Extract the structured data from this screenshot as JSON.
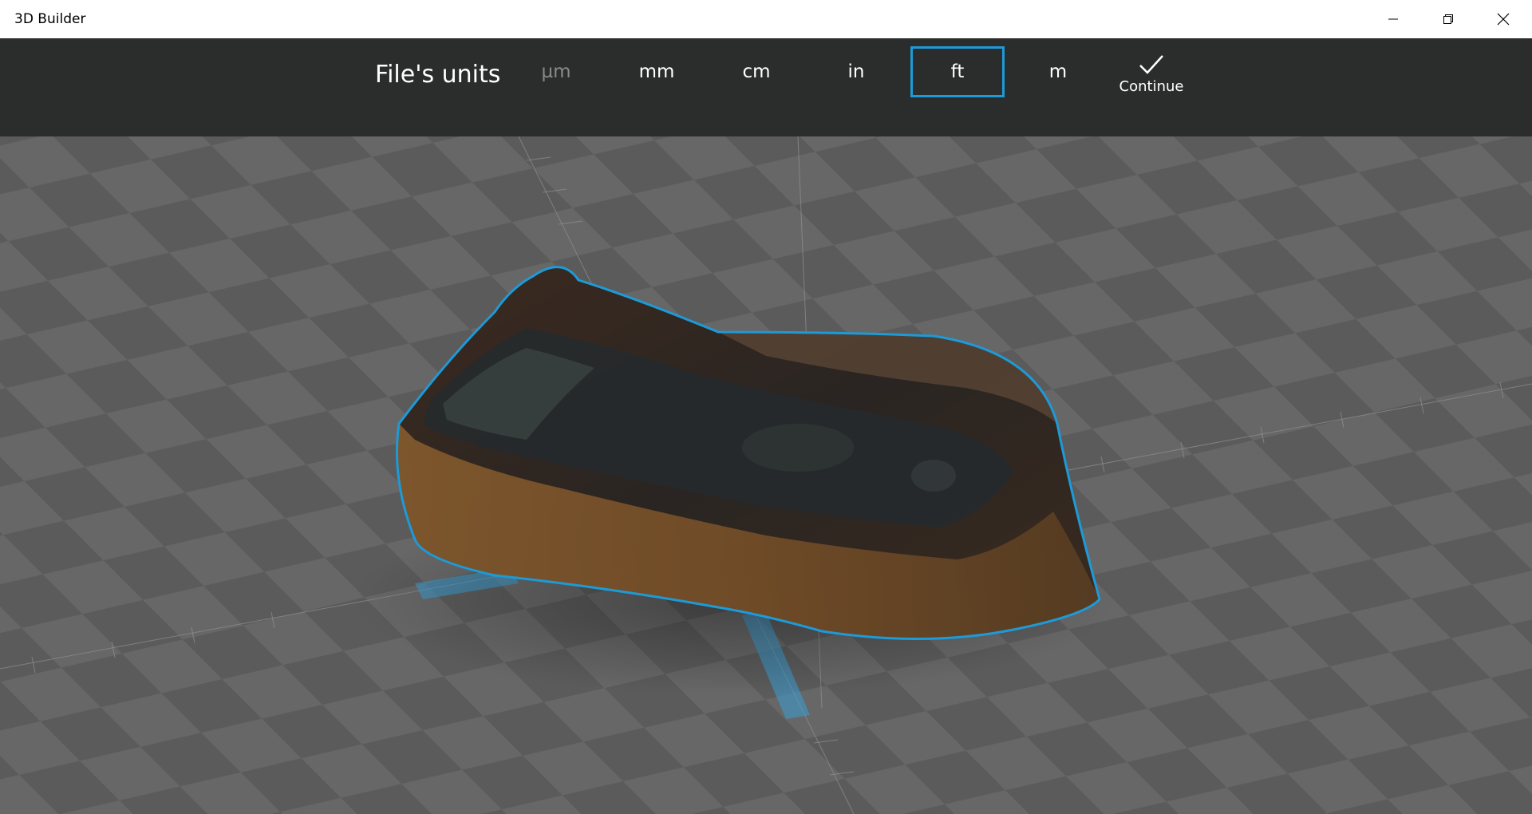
{
  "window": {
    "title": "3D Builder",
    "controls": [
      "minimize",
      "restore",
      "close"
    ]
  },
  "units_bar": {
    "title": "File's units",
    "options": [
      {
        "label": "µm",
        "state": "disabled"
      },
      {
        "label": "mm",
        "state": "normal"
      },
      {
        "label": "cm",
        "state": "normal"
      },
      {
        "label": "in",
        "state": "normal"
      },
      {
        "label": "ft",
        "state": "selected"
      },
      {
        "label": "m",
        "state": "normal"
      }
    ],
    "continue_label": "Continue",
    "continue_icon": "checkmark-icon"
  },
  "viewport": {
    "object": "scanned multimeter 3D model",
    "selection_outline_color": "#1d9ad8",
    "grid_colors": [
      "#585858",
      "#646464"
    ]
  },
  "colors": {
    "accent": "#1d9ad8",
    "toolbar_bg": "#2b2d2d",
    "titlebar_bg": "#ffffff"
  }
}
